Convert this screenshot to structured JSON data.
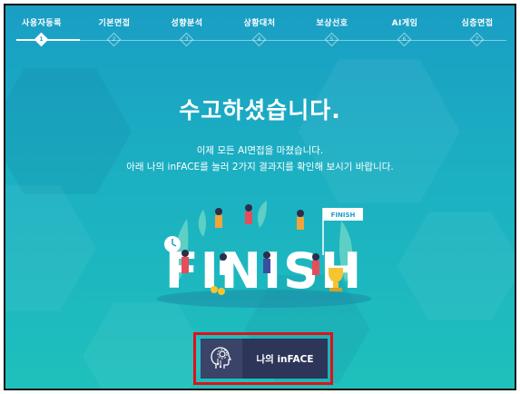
{
  "steps": [
    {
      "label": "사용자등록",
      "num": "1",
      "active": true
    },
    {
      "label": "기본면접",
      "num": "2",
      "active": false
    },
    {
      "label": "성향분석",
      "num": "3",
      "active": false
    },
    {
      "label": "상황대처",
      "num": "4",
      "active": false
    },
    {
      "label": "보상선호",
      "num": "5",
      "active": false
    },
    {
      "label": "AI게임",
      "num": "6",
      "active": false
    },
    {
      "label": "심층면접",
      "num": "7",
      "active": false
    }
  ],
  "main": {
    "title": "수고하셨습니다.",
    "message_line1": "이제 모든 AI면접을 마쳤습니다.",
    "message_line2": "아래 나의 inFACE를 눌러 2가지 결과지를 확인해 보시기 바랍니다.",
    "illustration_word": "FINISH",
    "flag_text": "FINISH"
  },
  "cta": {
    "label": "나의 inFACE",
    "icon": "ai-head-gear-icon"
  },
  "colors": {
    "bg_top": "#1a9ec4",
    "bg_bottom": "#1fc0bc",
    "cta_bg": "#2d3558",
    "highlight": "#e0101a"
  }
}
